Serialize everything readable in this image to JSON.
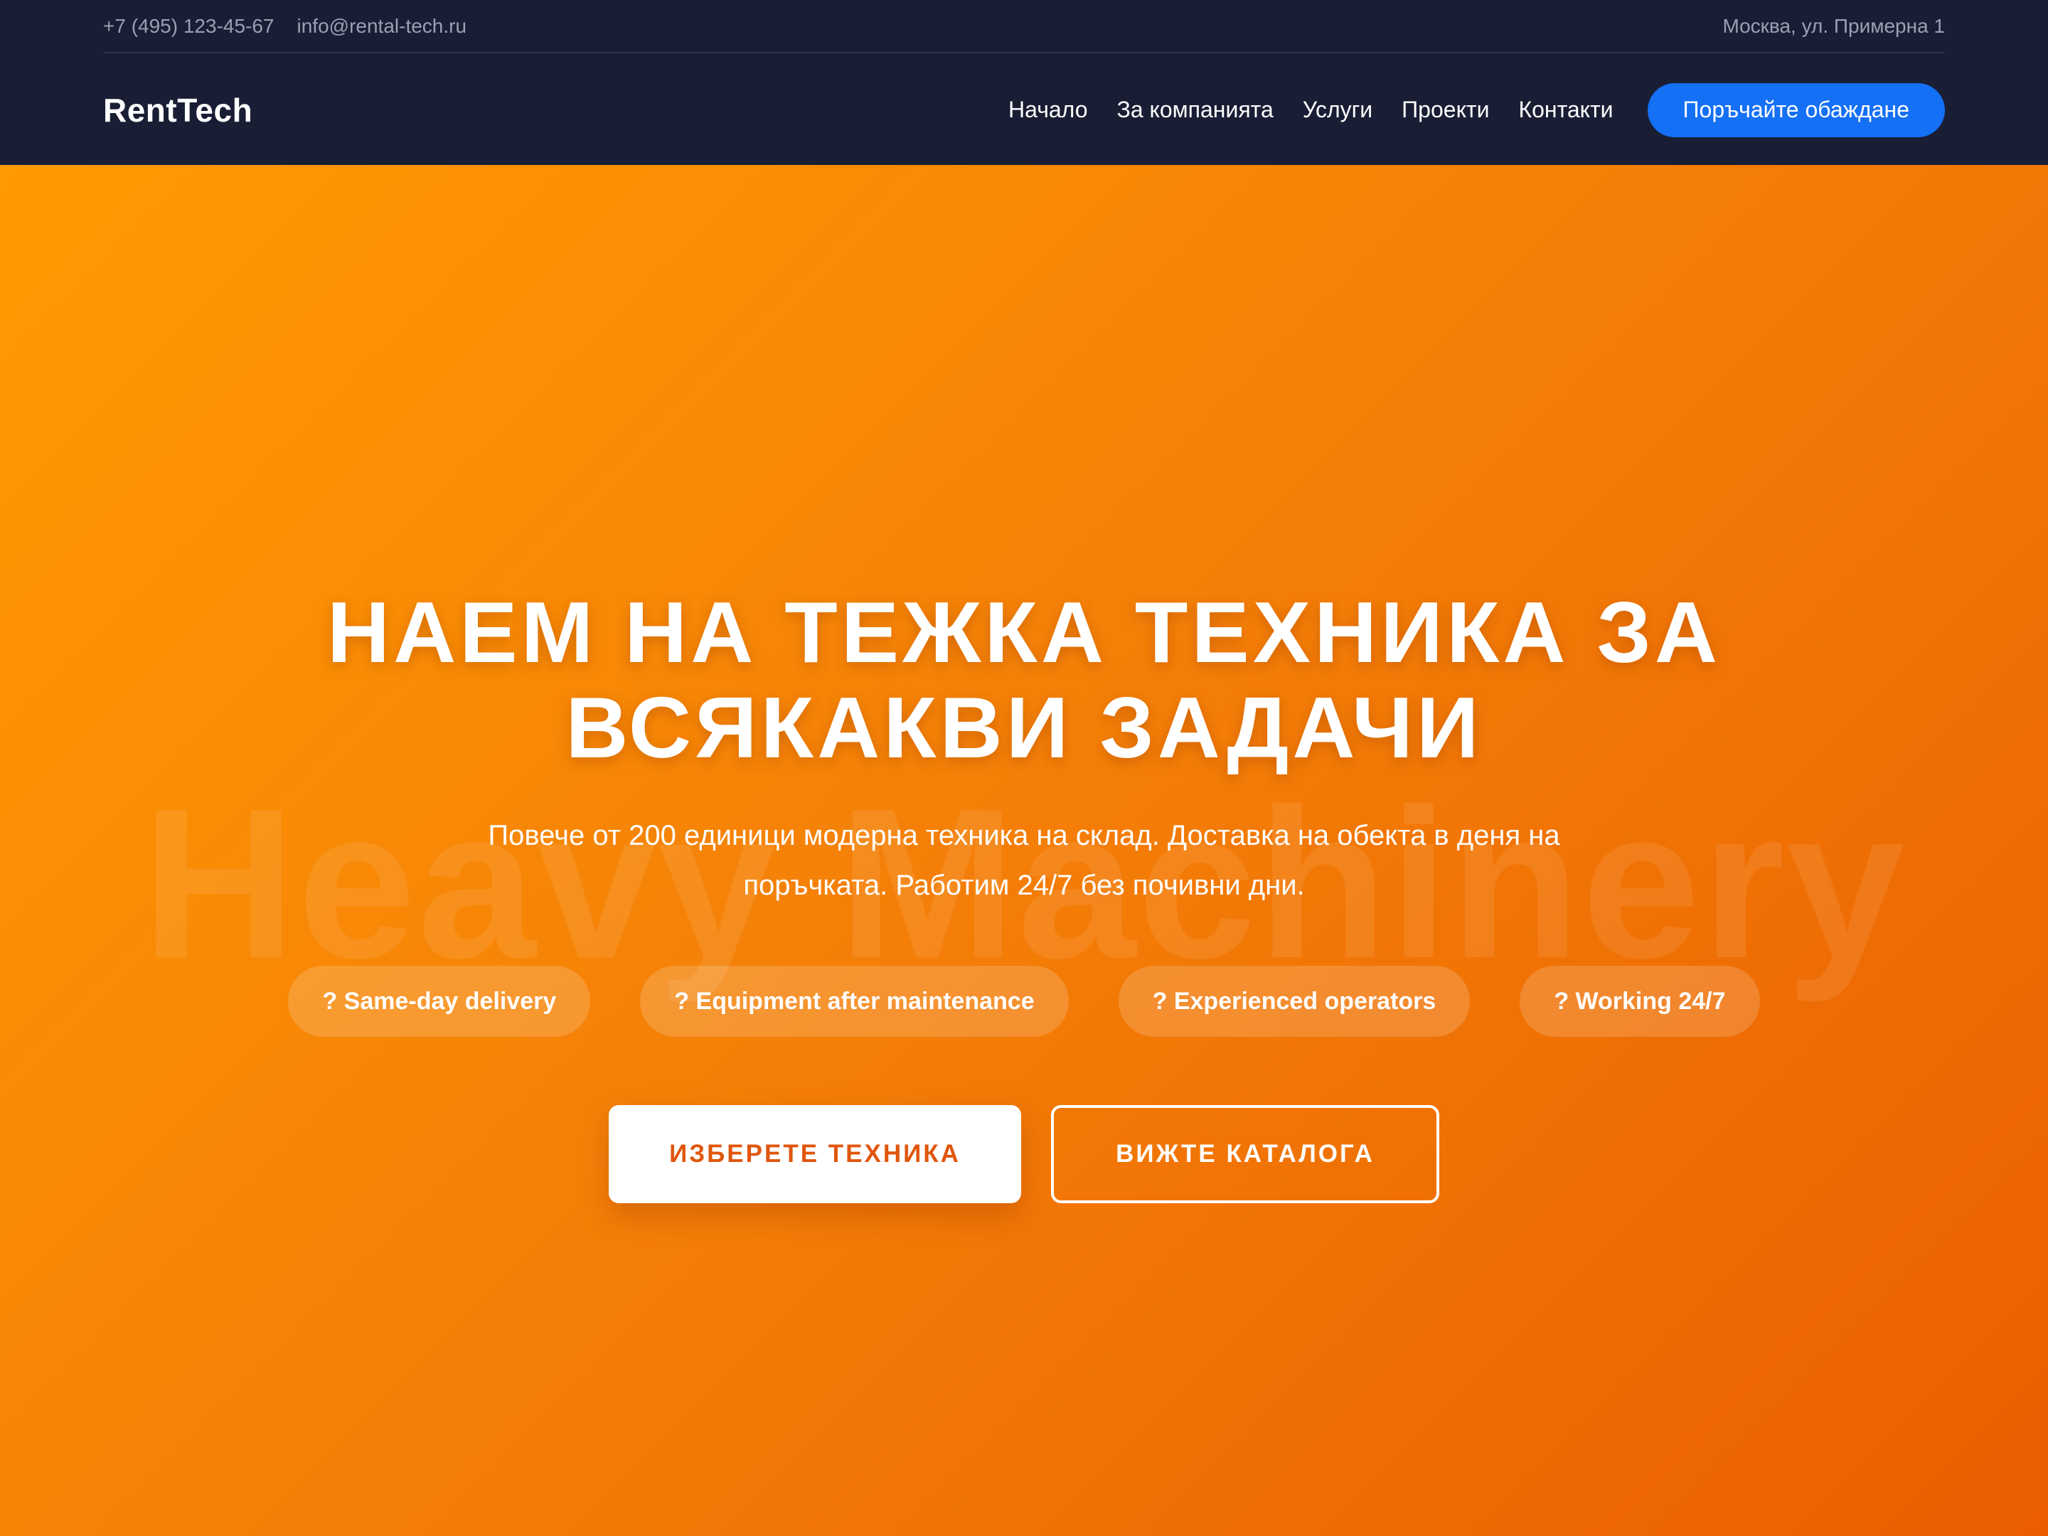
{
  "topbar": {
    "phone": "+7 (495) 123-45-67",
    "email": "info@rental-tech.ru",
    "address": "Москва, ул. Примерна 1"
  },
  "nav": {
    "logo": "RentTech",
    "links": [
      "Начало",
      "За компанията",
      "Услуги",
      "Проекти",
      "Контакти"
    ],
    "cta": "Поръчайте обаждане"
  },
  "hero": {
    "watermark": "Heavy Machinery",
    "title_line1": "НАЕМ НА ТЕЖКА ТЕХНИКА ЗА",
    "title_line2": "ВСЯКАКВИ ЗАДАЧИ",
    "subtitle_line1": "Повече от 200 единици модерна техника на склад. Доставка на обекта в деня на",
    "subtitle_line2": "поръчката. Работим 24/7 без почивни дни.",
    "features": [
      "? Same-day delivery",
      "? Equipment after maintenance",
      "? Experienced operators",
      "? Working 24/7"
    ],
    "primary_button": "ИЗБЕРЕТЕ ТЕХНИКА",
    "secondary_button": "ВИЖТЕ КАТАЛОГА"
  },
  "colors": {
    "header_bg": "#191e35",
    "cta_blue": "#1470f5",
    "hero_orange_start": "#ff9a00",
    "hero_orange_end": "#ea5e00",
    "primary_button_text": "#e0560c"
  }
}
